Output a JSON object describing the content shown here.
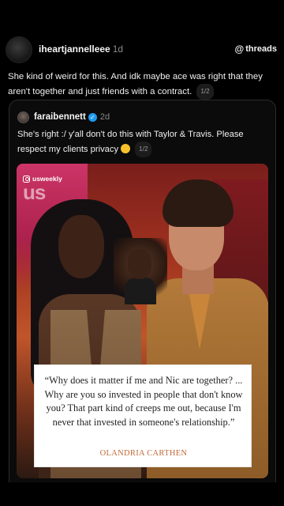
{
  "post": {
    "username": "iheartjannelleee",
    "time": "1d",
    "brand": "threads",
    "text": "She kind of weird for this. And idk maybe ace was right that they aren't together and just friends with a contract.",
    "pager": "1/2"
  },
  "quote": {
    "username": "faraibennett",
    "time": "2d",
    "text": "She's right :/ y'all don't do this with Taylor & Travis. Please respect my clients privacy",
    "pager": "1/2"
  },
  "media": {
    "handle": "usweekly",
    "logo": "us",
    "caption_text": "“Why does it matter if me and Nic are together? ... Why are you so invested in people that don't know you? That part kind of creeps me out, because I'm never that invested in someone's relationship.”",
    "caption_name": "OLANDRIA CARTHEN"
  },
  "icons": {
    "brand": "threads-logo-icon",
    "verified": "verified-badge-icon",
    "emoji": "pensive-face-emoji-icon",
    "instagram": "instagram-icon"
  },
  "colors": {
    "background": "#000000",
    "verified": "#1d9bf0",
    "caption_name": "#c26a3a"
  }
}
